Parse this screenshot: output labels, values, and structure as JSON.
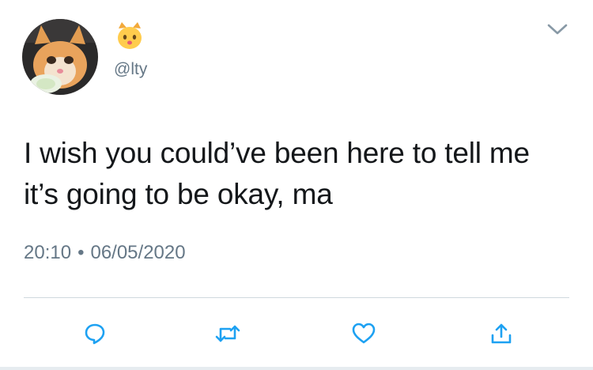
{
  "tweet": {
    "handle": "@lty",
    "name_emoji_icon": "cat-face-emoji",
    "text": "I wish you could’ve been here to tell me it’s going to be okay, ma",
    "time": "20:10",
    "separator": "•",
    "date": "06/05/2020"
  },
  "colors": {
    "text": "#14171a",
    "secondary": "#657786",
    "icon": "#1da1f2",
    "divider": "#cfd9de"
  },
  "actions": [
    "reply-icon",
    "retweet-icon",
    "like-icon",
    "share-icon"
  ],
  "menu_icon": "chevron-down-icon"
}
